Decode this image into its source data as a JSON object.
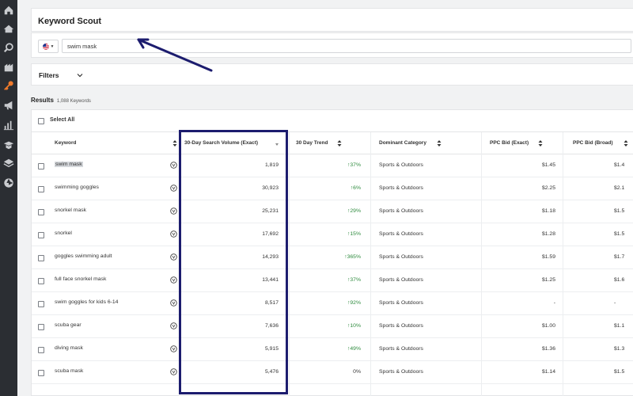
{
  "app": {
    "title": "Keyword Scout"
  },
  "sidebar": {
    "icons": [
      "home-icon",
      "house-icon",
      "search-icon",
      "building-icon",
      "key-icon",
      "megaphone-icon",
      "bar-chart-icon",
      "graduation-cap-icon",
      "stack-icon",
      "aperture-icon"
    ],
    "active_icon": "key-icon",
    "accent_color": "#f07a2b"
  },
  "search": {
    "value": "swim mask",
    "country": "US"
  },
  "filters": {
    "label": "Filters"
  },
  "results": {
    "label": "Results",
    "count": "1,088 Keywords"
  },
  "table": {
    "select_all_label": "Select All",
    "columns": [
      "Keyword",
      "30-Day Search Volume (Exact)",
      "30 Day Trend",
      "Dominant Category",
      "PPC Bid (Exact)",
      "PPC Bid (Broad)"
    ],
    "rows": [
      {
        "keyword": "swim mask",
        "volume": "1,819",
        "trend": "37%",
        "trend_dir": "up",
        "category": "Sports & Outdoors",
        "ppc_exact": "$1.45",
        "ppc_broad": "$1.4"
      },
      {
        "keyword": "swimming goggles",
        "volume": "30,923",
        "trend": "6%",
        "trend_dir": "up",
        "category": "Sports & Outdoors",
        "ppc_exact": "$2.25",
        "ppc_broad": "$2.1"
      },
      {
        "keyword": "snorkel mask",
        "volume": "25,231",
        "trend": "29%",
        "trend_dir": "up",
        "category": "Sports & Outdoors",
        "ppc_exact": "$1.18",
        "ppc_broad": "$1.5"
      },
      {
        "keyword": "snorkel",
        "volume": "17,692",
        "trend": "15%",
        "trend_dir": "up",
        "category": "Sports & Outdoors",
        "ppc_exact": "$1.28",
        "ppc_broad": "$1.5"
      },
      {
        "keyword": "goggles swimming adult",
        "volume": "14,293",
        "trend": "365%",
        "trend_dir": "up",
        "category": "Sports & Outdoors",
        "ppc_exact": "$1.59",
        "ppc_broad": "$1.7"
      },
      {
        "keyword": "full face snorkel mask",
        "volume": "13,441",
        "trend": "37%",
        "trend_dir": "up",
        "category": "Sports & Outdoors",
        "ppc_exact": "$1.25",
        "ppc_broad": "$1.6"
      },
      {
        "keyword": "swim goggles for kids 6-14",
        "volume": "8,517",
        "trend": "92%",
        "trend_dir": "up",
        "category": "Sports & Outdoors",
        "ppc_exact": "-",
        "ppc_broad": "-"
      },
      {
        "keyword": "scuba gear",
        "volume": "7,636",
        "trend": "10%",
        "trend_dir": "up",
        "category": "Sports & Outdoors",
        "ppc_exact": "$1.00",
        "ppc_broad": "$1.1"
      },
      {
        "keyword": "diving mask",
        "volume": "5,915",
        "trend": "49%",
        "trend_dir": "up",
        "category": "Sports & Outdoors",
        "ppc_exact": "$1.36",
        "ppc_broad": "$1.3"
      },
      {
        "keyword": "scuba mask",
        "volume": "5,476",
        "trend": "0%",
        "trend_dir": "flat",
        "category": "Sports & Outdoors",
        "ppc_exact": "$1.14",
        "ppc_broad": "$1.5"
      }
    ]
  },
  "annotation": {
    "color": "#1c1c6e"
  },
  "colors": {
    "trend_up": "#2e8b3e",
    "panel": "#ffffff",
    "sidebar": "#2b2e33"
  }
}
